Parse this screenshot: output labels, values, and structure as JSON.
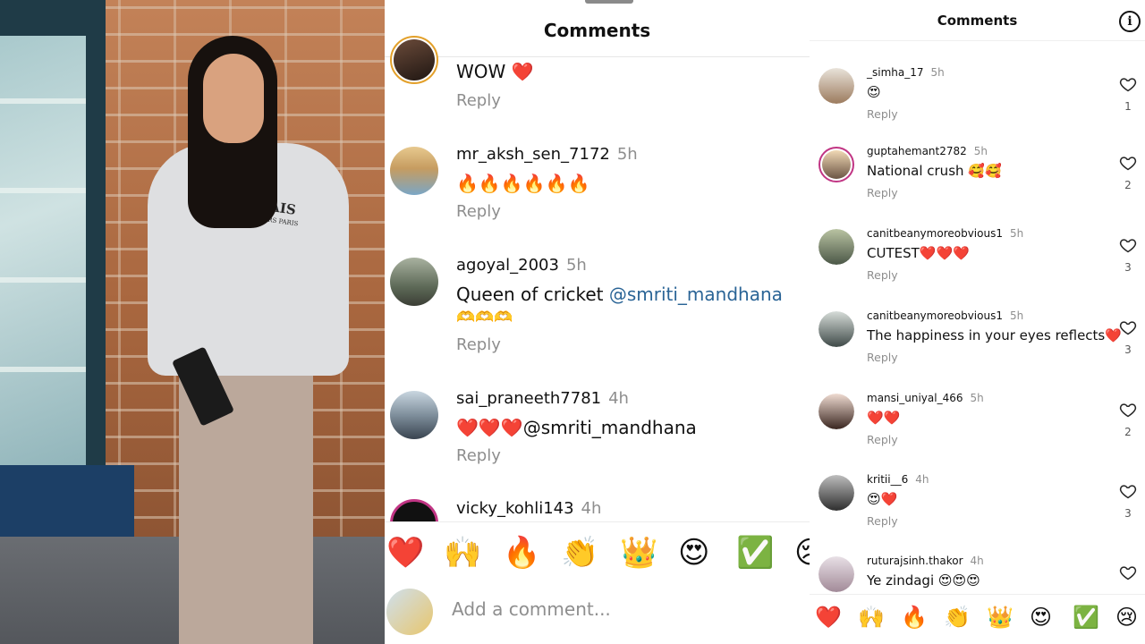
{
  "middle": {
    "title": "Comments",
    "comments": [
      {
        "user": "",
        "time": "",
        "text": "WOW ❤️",
        "reply": "Reply"
      },
      {
        "user": "mr_aksh_sen_7172",
        "time": "5h",
        "text": "🔥🔥🔥🔥🔥🔥",
        "reply": "Reply"
      },
      {
        "user": "agoyal_2003",
        "time": "5h",
        "text": "Queen of cricket ",
        "mention": "@smriti_mandhana",
        "text2": "🫶🫶🫶",
        "reply": "Reply"
      },
      {
        "user": "sai_praneeth7781",
        "time": "4h",
        "text": "❤️❤️❤️@smriti_mandhana",
        "reply": "Reply"
      },
      {
        "user": "vicky_kohli143",
        "time": "4h",
        "text": "",
        "reply": ""
      }
    ],
    "emojis": [
      "❤️",
      "🙌",
      "🔥",
      "👏",
      "👑",
      "😍",
      "✅",
      "😢"
    ],
    "add_comment_placeholder": "Add a comment..."
  },
  "right": {
    "title": "Comments",
    "comments": [
      {
        "user": "_simha_17",
        "time": "5h",
        "text": "😍",
        "reply": "Reply",
        "likes": "1"
      },
      {
        "user": "guptahemant2782",
        "time": "5h",
        "text": "National crush 🥰🥰",
        "reply": "Reply",
        "likes": "2"
      },
      {
        "user": "canitbeanymoreobvious1",
        "time": "5h",
        "text": "CUTEST❤️❤️❤️",
        "reply": "Reply",
        "likes": "3"
      },
      {
        "user": "canitbeanymoreobvious1",
        "time": "5h",
        "text": "The happiness in your eyes reflects❤️",
        "reply": "Reply",
        "likes": "3"
      },
      {
        "user": "mansi_uniyal_466",
        "time": "5h",
        "text": "❤️❤️",
        "reply": "Reply",
        "likes": "2"
      },
      {
        "user": "kritii__6",
        "time": "4h",
        "text": "😍❤️",
        "reply": "Reply",
        "likes": "3"
      },
      {
        "user": "ruturajsinh.thakor",
        "time": "4h",
        "text": "Ye zindagi 😍😍😍",
        "reply": "",
        "likes": ""
      }
    ],
    "emojis": [
      "❤️",
      "🙌",
      "🔥",
      "👏",
      "👑",
      "😍",
      "✅",
      "😢"
    ]
  },
  "photo": {
    "sweater_text": "LE MARAIS",
    "sweater_subtext": "RUE DES ROSIERS PARIS"
  },
  "colors": {
    "mention": "#2a6496",
    "muted": "#8e8e8e",
    "story_ring": "#c13584"
  }
}
